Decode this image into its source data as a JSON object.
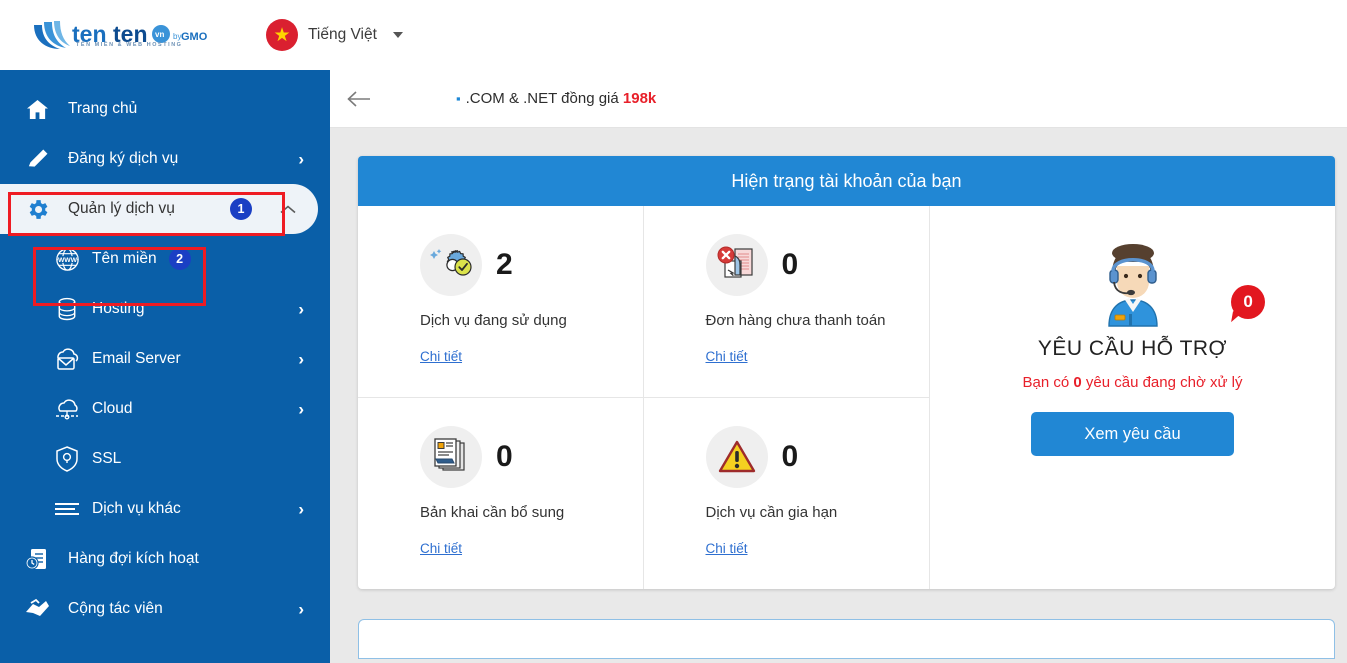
{
  "topbar": {
    "logo": {
      "name_part1": "ten",
      "name_part2": "ten",
      "badge": "vn",
      "by": "by GMO",
      "tagline": "TÊN MIỀN & WEB HOSTING"
    },
    "language": {
      "icon": "vietnam-flag-icon",
      "star": "★",
      "label": "Tiếng Việt",
      "caret": "chevron-down-icon"
    }
  },
  "sidebar": {
    "items": [
      {
        "label": "Trang chủ",
        "icon": "home-icon",
        "chevron": "",
        "badge": "",
        "active": false
      },
      {
        "label": "Đăng ký dịch vụ",
        "icon": "pencil-icon",
        "chevron": "›",
        "badge": "",
        "active": false
      },
      {
        "label": "Quản lý dịch vụ",
        "icon": "gear-icon",
        "chevron": "⌃",
        "badge": "1",
        "active": true
      },
      {
        "label": "Tên miền",
        "icon": "globe-www-icon",
        "chevron": "",
        "badge": "2",
        "active": false,
        "sub": true
      },
      {
        "label": "Hosting",
        "icon": "database-icon",
        "chevron": "›",
        "badge": "",
        "active": false,
        "sub": true
      },
      {
        "label": "Email Server",
        "icon": "mail-cloud-icon",
        "chevron": "›",
        "badge": "",
        "active": false,
        "sub": true
      },
      {
        "label": "Cloud",
        "icon": "cloud-icon",
        "chevron": "›",
        "badge": "",
        "active": false,
        "sub": true
      },
      {
        "label": "SSL",
        "icon": "shield-lock-icon",
        "chevron": "",
        "badge": "",
        "active": false,
        "sub": true
      },
      {
        "label": "Dịch vụ khác",
        "icon": "list-lines-icon",
        "chevron": "›",
        "badge": "",
        "active": false,
        "sub": true
      },
      {
        "label": "Hàng đợi kích hoạt",
        "icon": "queue-clock-icon",
        "chevron": "",
        "badge": "",
        "active": false
      },
      {
        "label": "Cộng tác viên",
        "icon": "handshake-icon",
        "chevron": "›",
        "badge": "",
        "active": false
      }
    ],
    "annotations": [
      {
        "number": "1",
        "target": "Quản lý dịch vụ"
      },
      {
        "number": "2",
        "target": "Tên miền"
      }
    ]
  },
  "promo": {
    "back_icon": "back-arrow-icon",
    "bullet": "▪",
    "text": ".COM & .NET đồng giá ",
    "price": "198k"
  },
  "account_card": {
    "title": "Hiện trạng tài khoản của bạn",
    "stats": [
      {
        "icon": "gear-check-icon",
        "value": "2",
        "label": "Dịch vụ đang sử dụng",
        "link": "Chi tiết"
      },
      {
        "icon": "invoice-error-icon",
        "value": "0",
        "label": "Đơn hàng chưa thanh toán",
        "link": "Chi tiết"
      },
      {
        "icon": "documents-icon",
        "value": "0",
        "label": "Bản khai cần bổ sung",
        "link": "Chi tiết"
      },
      {
        "icon": "warning-triangle-icon",
        "value": "0",
        "label": "Dịch vụ cần gia hạn",
        "link": "Chi tiết"
      }
    ],
    "support": {
      "avatar_icon": "support-agent-icon",
      "title": "YÊU CẦU HỖ TRỢ",
      "badge": "0",
      "sub_prefix": "Bạn có ",
      "sub_count": "0",
      "sub_suffix": " yêu cầu đang chờ xử lý",
      "button": "Xem yêu cầu"
    }
  },
  "colors": {
    "sidebar_blue": "#0a5fa8",
    "accent_blue": "#2187d4",
    "badge_blue": "#1a3fc4",
    "annotation_red": "#ee1b23",
    "alert_red": "#e8202a",
    "page_bg": "#e9e9e9"
  }
}
